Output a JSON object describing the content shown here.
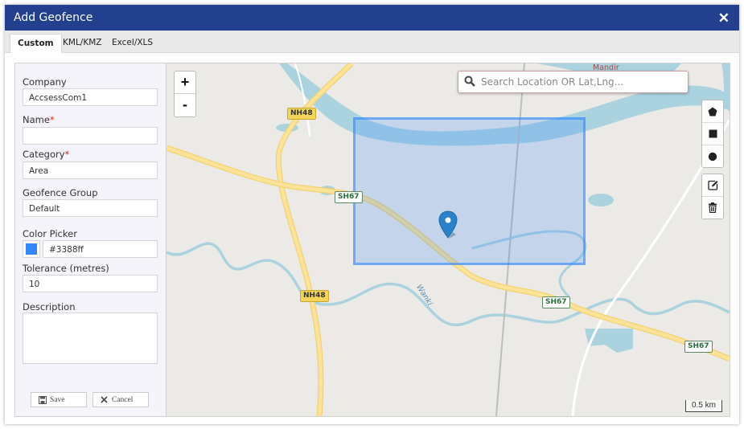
{
  "dialog": {
    "title": "Add Geofence",
    "close_icon": "close-icon"
  },
  "tabs": [
    {
      "label": "Custom",
      "active": true
    },
    {
      "label": "KML/KMZ",
      "active": false
    },
    {
      "label": "Excel/XLS",
      "active": false
    }
  ],
  "form": {
    "company": {
      "label": "Company",
      "value": "AccsessCom1"
    },
    "name": {
      "label": "Name",
      "required": "*",
      "value": ""
    },
    "category": {
      "label": "Category",
      "required": "*",
      "value": "Area"
    },
    "group": {
      "label": "Geofence Group",
      "value": "Default"
    },
    "color": {
      "label": "Color Picker",
      "value": "#3388ff"
    },
    "tolerance": {
      "label": "Tolerance (metres)",
      "value": "10"
    },
    "description": {
      "label": "Description",
      "value": ""
    },
    "save_label": "Save",
    "cancel_label": "Cancel"
  },
  "map": {
    "search_placeholder": "Search Location OR Lat,Lng...",
    "zoom_in": "+",
    "zoom_out": "-",
    "scale": "0.5 km",
    "labels": {
      "nh48_top": "NH48",
      "nh48_bottom": "NH48",
      "sh67_left": "SH67",
      "sh67_mid": "SH67",
      "sh67_right": "SH67",
      "mandir": "Mandir",
      "wanki": "Wanki"
    },
    "tools": [
      "polygon-tool",
      "rectangle-tool",
      "circle-tool",
      "edit-tool",
      "delete-tool"
    ],
    "colors": {
      "water": "#aad3df",
      "road": "#fbe39a",
      "fence": "#3388ff",
      "header": "#23408e"
    }
  }
}
